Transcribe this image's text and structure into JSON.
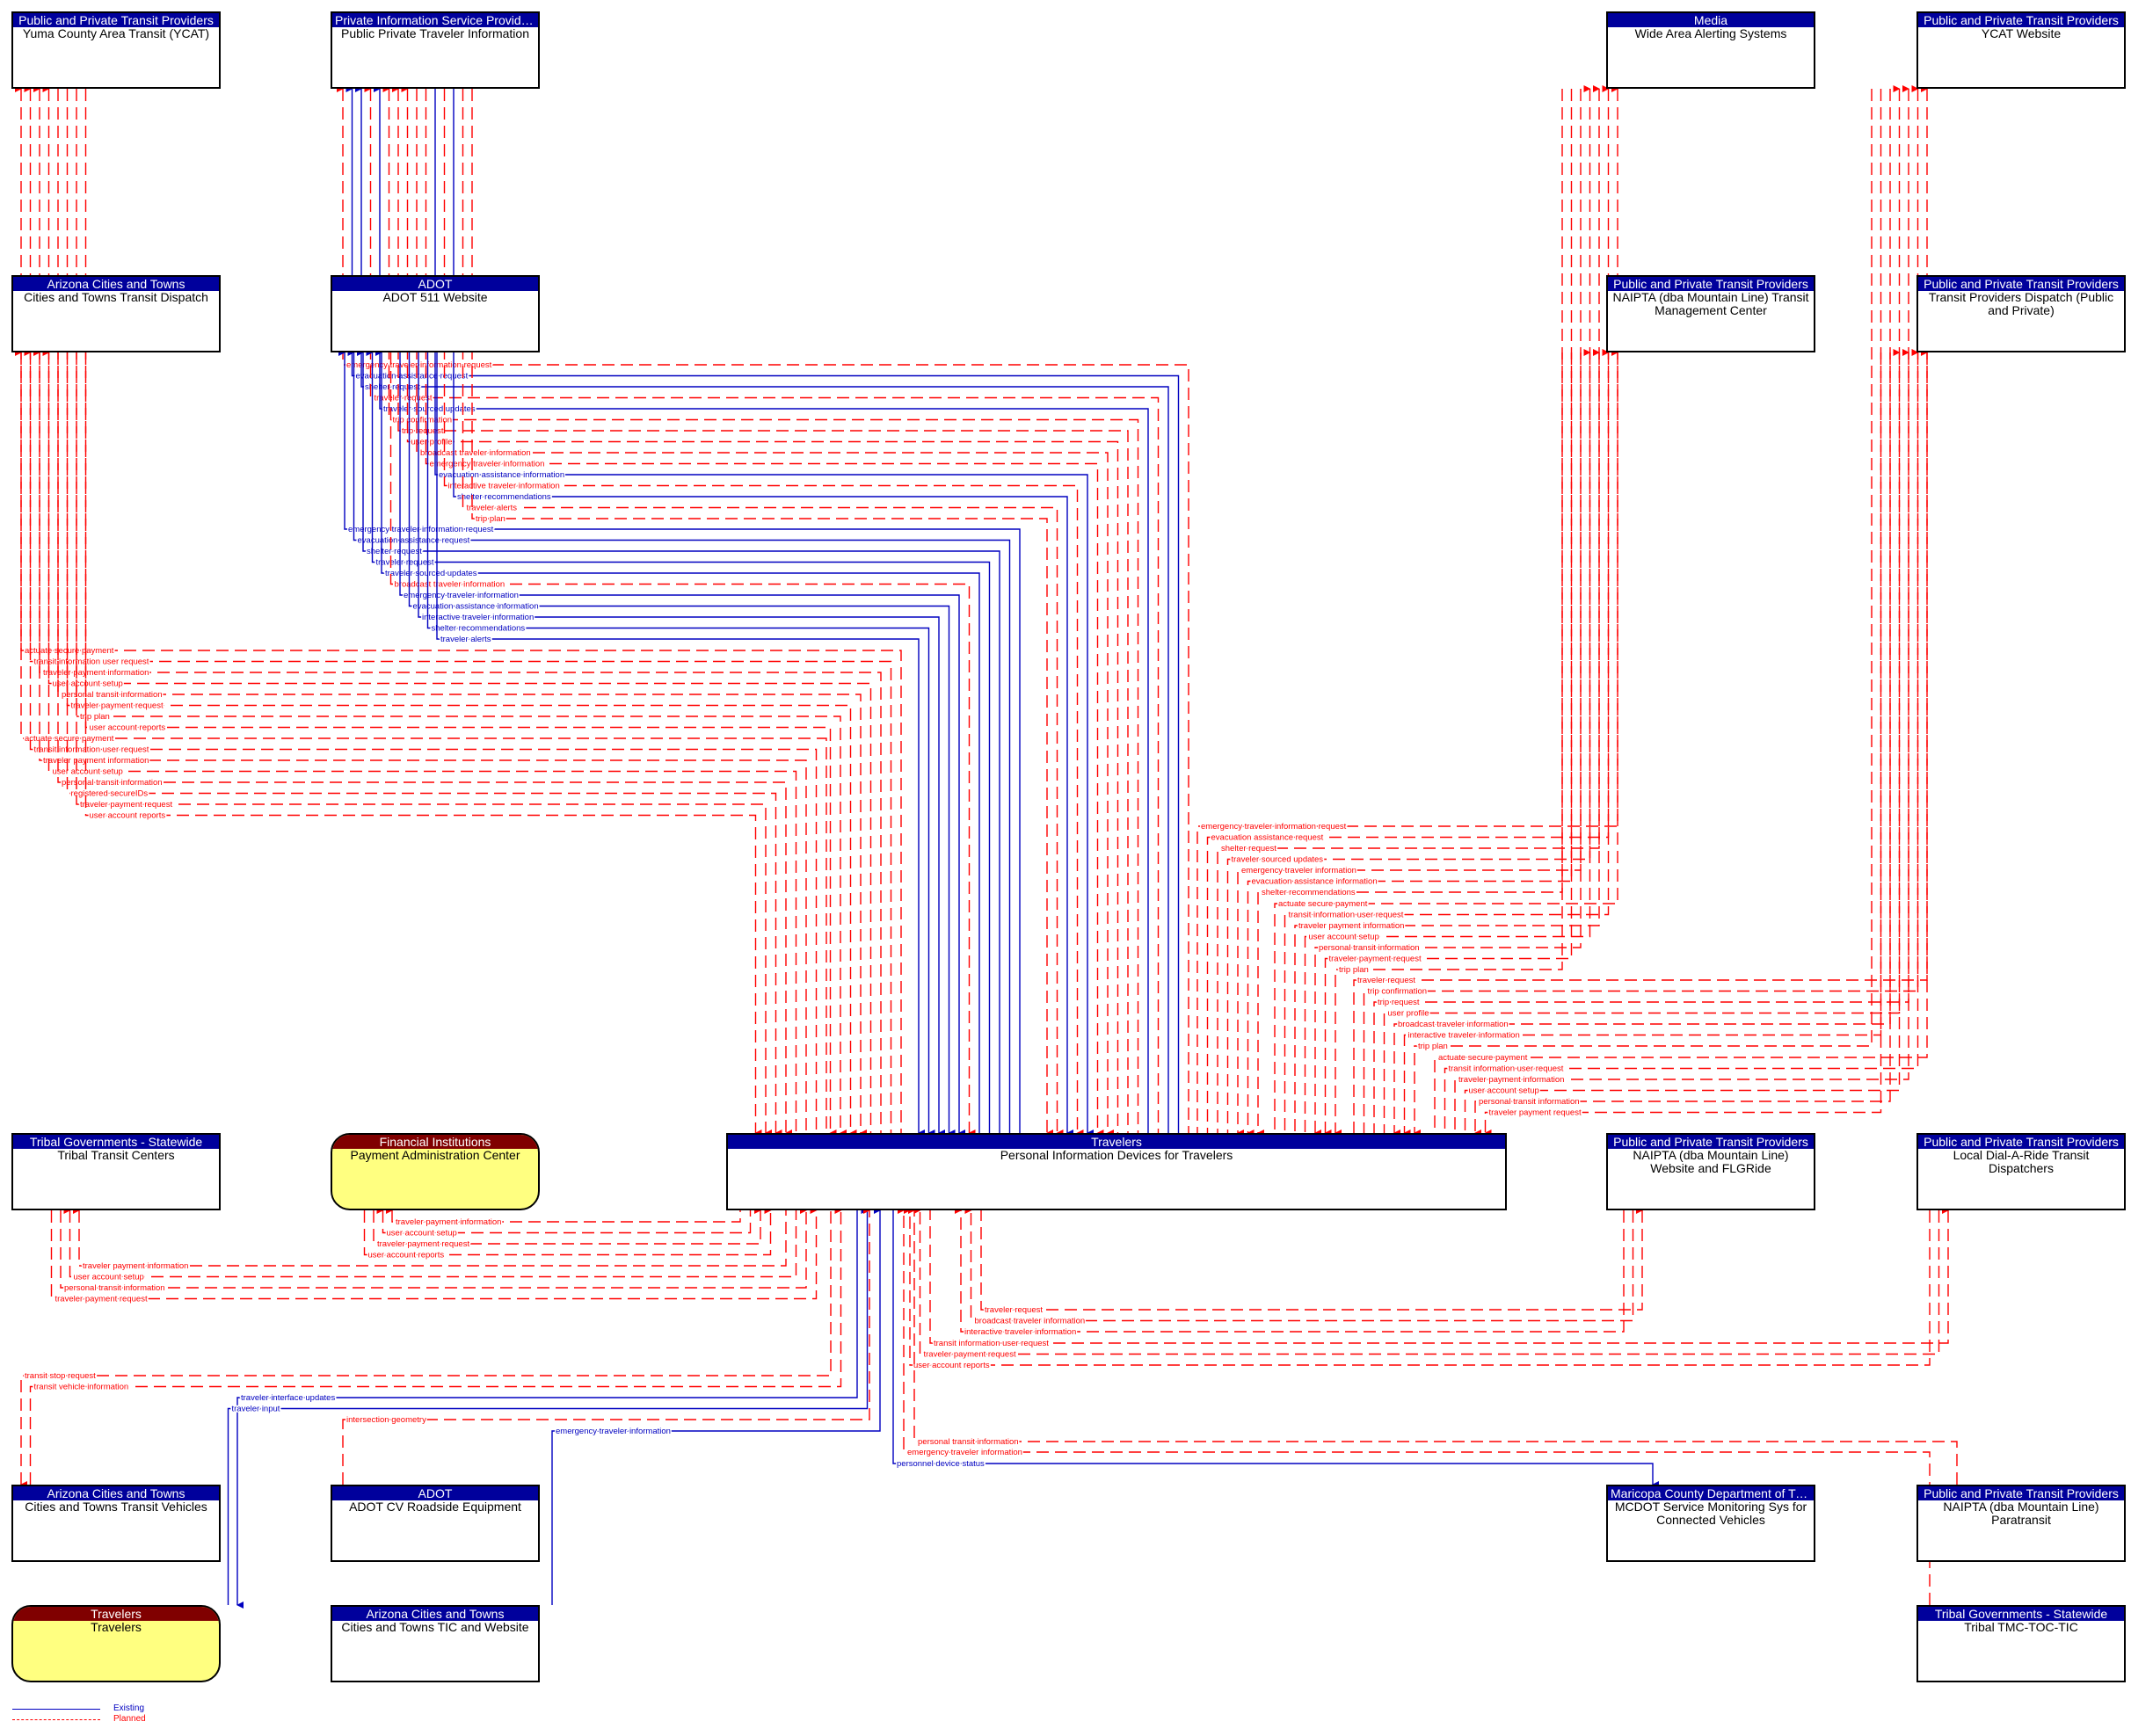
{
  "legend": {
    "existing_label": "Existing",
    "planned_label": "Planned",
    "existing_color": "#0000c0",
    "planned_color": "#ff0000"
  },
  "colors": {
    "element_header": "#00009c",
    "actor_header": "#800000",
    "actor_fill": "#ffff80"
  },
  "nodes": [
    {
      "id": "ycat",
      "category": "Public and Private Transit Providers",
      "name": "Yuma County Area Transit (YCAT)",
      "kind": "element"
    },
    {
      "id": "ppti",
      "category": "Private Information Service Providers",
      "name": "Public Private Traveler Information",
      "kind": "element"
    },
    {
      "id": "waas",
      "category": "Media",
      "name": "Wide Area Alerting Systems",
      "kind": "element"
    },
    {
      "id": "ycatweb",
      "category": "Public and Private Transit Providers",
      "name": "YCAT Website",
      "kind": "element"
    },
    {
      "id": "cttd",
      "category": "Arizona Cities and Towns",
      "name": "Cities and Towns Transit Dispatch",
      "kind": "element"
    },
    {
      "id": "adot511",
      "category": "ADOT",
      "name": "ADOT 511 Website",
      "kind": "element"
    },
    {
      "id": "naiptatmc",
      "category": "Public and Private Transit Providers",
      "name": "NAIPTA (dba Mountain Line) Transit Management Center",
      "kind": "element"
    },
    {
      "id": "tpd",
      "category": "Public and Private Transit Providers",
      "name": "Transit Providers Dispatch (Public and Private)",
      "kind": "element"
    },
    {
      "id": "ttc",
      "category": "Tribal Governments - Statewide",
      "name": "Tribal Transit Centers",
      "kind": "element"
    },
    {
      "id": "pac",
      "category": "Financial Institutions",
      "name": "Payment Administration Center",
      "kind": "actor"
    },
    {
      "id": "pid",
      "category": "Travelers",
      "name": "Personal Information Devices for Travelers",
      "kind": "element"
    },
    {
      "id": "naiptaweb",
      "category": "Public and Private Transit Providers",
      "name": "NAIPTA (dba Mountain Line) Website and FLGRide",
      "kind": "element"
    },
    {
      "id": "ldar",
      "category": "Public and Private Transit Providers",
      "name": "Local Dial-A-Ride Transit Dispatchers",
      "kind": "element"
    },
    {
      "id": "cttv",
      "category": "Arizona Cities and Towns",
      "name": "Cities and Towns Transit Vehicles",
      "kind": "element"
    },
    {
      "id": "adotcv",
      "category": "ADOT",
      "name": "ADOT CV Roadside Equipment",
      "kind": "element"
    },
    {
      "id": "mcdot",
      "category": "Maricopa County Department of Tran...",
      "name": "MCDOT Service Monitoring Sys for Connected Vehicles",
      "kind": "element"
    },
    {
      "id": "naiptapara",
      "category": "Public and Private Transit Providers",
      "name": "NAIPTA (dba Mountain Line) Paratransit",
      "kind": "element"
    },
    {
      "id": "travelers",
      "category": "Travelers",
      "name": "Travelers",
      "kind": "actor"
    },
    {
      "id": "cttic",
      "category": "Arizona Cities and Towns",
      "name": "Cities and Towns TIC and Website",
      "kind": "element"
    },
    {
      "id": "tribaltmc",
      "category": "Tribal Governments - Statewide",
      "name": "Tribal TMC-TOC-TIC",
      "kind": "element"
    }
  ],
  "flows": [
    {
      "group": "ppti",
      "label": "emergency traveler information request",
      "status": "planned",
      "to": "ppti"
    },
    {
      "group": "ppti",
      "label": "evacuation assistance request",
      "status": "existing",
      "to": "ppti"
    },
    {
      "group": "ppti",
      "label": "shelter request",
      "status": "existing",
      "to": "ppti"
    },
    {
      "group": "ppti",
      "label": "traveler request",
      "status": "planned",
      "to": "ppti"
    },
    {
      "group": "ppti",
      "label": "traveler sourced updates",
      "status": "existing",
      "to": "ppti"
    },
    {
      "group": "ppti",
      "label": "trip confirmation",
      "status": "planned",
      "to": "ppti"
    },
    {
      "group": "ppti",
      "label": "trip request",
      "status": "planned",
      "to": "ppti"
    },
    {
      "group": "ppti",
      "label": "user profile",
      "status": "planned",
      "to": "ppti"
    },
    {
      "group": "ppti",
      "label": "broadcast traveler information",
      "status": "planned",
      "to": "pid"
    },
    {
      "group": "ppti",
      "label": "emergency traveler information",
      "status": "planned",
      "to": "pid"
    },
    {
      "group": "ppti",
      "label": "evacuation assistance information",
      "status": "existing",
      "to": "pid"
    },
    {
      "group": "ppti",
      "label": "interactive traveler information",
      "status": "planned",
      "to": "pid"
    },
    {
      "group": "ppti",
      "label": "shelter recommendations",
      "status": "existing",
      "to": "pid"
    },
    {
      "group": "ppti",
      "label": "traveler alerts",
      "status": "planned",
      "to": "pid"
    },
    {
      "group": "ppti",
      "label": "trip plan",
      "status": "planned",
      "to": "pid"
    },
    {
      "group": "adot511",
      "label": "emergency traveler information request",
      "status": "existing",
      "to": "adot511"
    },
    {
      "group": "adot511",
      "label": "evacuation assistance request",
      "status": "existing",
      "to": "adot511"
    },
    {
      "group": "adot511",
      "label": "shelter request",
      "status": "existing",
      "to": "adot511"
    },
    {
      "group": "adot511",
      "label": "traveler request",
      "status": "existing",
      "to": "adot511"
    },
    {
      "group": "adot511",
      "label": "traveler sourced updates",
      "status": "existing",
      "to": "adot511"
    },
    {
      "group": "adot511",
      "label": "broadcast traveler information",
      "status": "planned",
      "to": "pid"
    },
    {
      "group": "adot511",
      "label": "emergency traveler information",
      "status": "existing",
      "to": "pid"
    },
    {
      "group": "adot511",
      "label": "evacuation assistance information",
      "status": "existing",
      "to": "pid"
    },
    {
      "group": "adot511",
      "label": "interactive traveler information",
      "status": "existing",
      "to": "pid"
    },
    {
      "group": "adot511",
      "label": "shelter recommendations",
      "status": "existing",
      "to": "pid"
    },
    {
      "group": "adot511",
      "label": "traveler alerts",
      "status": "existing",
      "to": "pid"
    },
    {
      "group": "ycat",
      "label": "actuate secure payment",
      "status": "planned",
      "to": "ycat"
    },
    {
      "group": "ycat",
      "label": "transit information user request",
      "status": "planned",
      "to": "ycat"
    },
    {
      "group": "ycat",
      "label": "traveler payment information",
      "status": "planned",
      "to": "ycat"
    },
    {
      "group": "ycat",
      "label": "user account setup",
      "status": "planned",
      "to": "ycat"
    },
    {
      "group": "ycat",
      "label": "personal transit information",
      "status": "planned",
      "to": "pid"
    },
    {
      "group": "ycat",
      "label": "traveler payment request",
      "status": "planned",
      "to": "pid"
    },
    {
      "group": "ycat",
      "label": "trip plan",
      "status": "planned",
      "to": "pid"
    },
    {
      "group": "ycat",
      "label": "user account reports",
      "status": "planned",
      "to": "pid"
    },
    {
      "group": "cttd",
      "label": "actuate secure payment",
      "status": "planned",
      "to": "cttd"
    },
    {
      "group": "cttd",
      "label": "transit information user request",
      "status": "planned",
      "to": "cttd"
    },
    {
      "group": "cttd",
      "label": "traveler payment information",
      "status": "planned",
      "to": "cttd"
    },
    {
      "group": "cttd",
      "label": "user account setup",
      "status": "planned",
      "to": "cttd"
    },
    {
      "group": "cttd",
      "label": "personal transit information",
      "status": "planned",
      "to": "pid"
    },
    {
      "group": "cttd",
      "label": "registered secureIDs",
      "status": "planned",
      "to": "pid"
    },
    {
      "group": "cttd",
      "label": "traveler payment request",
      "status": "planned",
      "to": "pid"
    },
    {
      "group": "cttd",
      "label": "user account reports",
      "status": "planned",
      "to": "pid"
    },
    {
      "group": "waas",
      "label": "emergency traveler information request",
      "status": "planned",
      "to": "waas"
    },
    {
      "group": "waas",
      "label": "evacuation assistance request",
      "status": "planned",
      "to": "waas"
    },
    {
      "group": "waas",
      "label": "shelter request",
      "status": "planned",
      "to": "waas"
    },
    {
      "group": "waas",
      "label": "traveler sourced updates",
      "status": "planned",
      "to": "waas"
    },
    {
      "group": "waas",
      "label": "emergency traveler information",
      "status": "planned",
      "to": "pid"
    },
    {
      "group": "waas",
      "label": "evacuation assistance information",
      "status": "planned",
      "to": "pid"
    },
    {
      "group": "waas",
      "label": "shelter recommendations",
      "status": "planned",
      "to": "pid"
    },
    {
      "group": "naiptatmc",
      "label": "actuate secure payment",
      "status": "planned",
      "to": "naiptatmc"
    },
    {
      "group": "naiptatmc",
      "label": "transit information user request",
      "status": "planned",
      "to": "naiptatmc"
    },
    {
      "group": "naiptatmc",
      "label": "traveler payment information",
      "status": "planned",
      "to": "naiptatmc"
    },
    {
      "group": "naiptatmc",
      "label": "user account setup",
      "status": "planned",
      "to": "naiptatmc"
    },
    {
      "group": "naiptatmc",
      "label": "personal transit information",
      "status": "planned",
      "to": "pid"
    },
    {
      "group": "naiptatmc",
      "label": "traveler payment request",
      "status": "planned",
      "to": "pid"
    },
    {
      "group": "naiptatmc",
      "label": "trip plan",
      "status": "planned",
      "to": "pid"
    },
    {
      "group": "ycatweb",
      "label": "traveler request",
      "status": "planned",
      "to": "ycatweb"
    },
    {
      "group": "ycatweb",
      "label": "trip confirmation",
      "status": "planned",
      "to": "ycatweb"
    },
    {
      "group": "ycatweb",
      "label": "trip request",
      "status": "planned",
      "to": "ycatweb"
    },
    {
      "group": "ycatweb",
      "label": "user profile",
      "status": "planned",
      "to": "ycatweb"
    },
    {
      "group": "ycatweb",
      "label": "broadcast traveler information",
      "status": "planned",
      "to": "pid"
    },
    {
      "group": "ycatweb",
      "label": "interactive traveler information",
      "status": "planned",
      "to": "pid"
    },
    {
      "group": "ycatweb",
      "label": "trip plan",
      "status": "planned",
      "to": "pid"
    },
    {
      "group": "tpd",
      "label": "actuate secure payment",
      "status": "planned",
      "to": "tpd"
    },
    {
      "group": "tpd",
      "label": "transit information user request",
      "status": "planned",
      "to": "tpd"
    },
    {
      "group": "tpd",
      "label": "traveler payment information",
      "status": "planned",
      "to": "tpd"
    },
    {
      "group": "tpd",
      "label": "user account setup",
      "status": "planned",
      "to": "tpd"
    },
    {
      "group": "tpd",
      "label": "personal transit information",
      "status": "planned",
      "to": "pid"
    },
    {
      "group": "tpd",
      "label": "traveler payment request",
      "status": "planned",
      "to": "pid"
    },
    {
      "group": "pac",
      "label": "traveler payment information",
      "status": "planned",
      "to": "pac"
    },
    {
      "group": "pac",
      "label": "user account setup",
      "status": "planned",
      "to": "pac"
    },
    {
      "group": "pac",
      "label": "traveler payment request",
      "status": "planned",
      "to": "pid"
    },
    {
      "group": "pac",
      "label": "user account reports",
      "status": "planned",
      "to": "pid"
    },
    {
      "group": "ttc",
      "label": "traveler payment information",
      "status": "planned",
      "to": "ttc"
    },
    {
      "group": "ttc",
      "label": "user account setup",
      "status": "planned",
      "to": "ttc"
    },
    {
      "group": "ttc",
      "label": "personal transit information",
      "status": "planned",
      "to": "pid"
    },
    {
      "group": "ttc",
      "label": "traveler payment request",
      "status": "planned",
      "to": "pid"
    },
    {
      "group": "cttv",
      "label": "transit stop request",
      "status": "planned",
      "to": "cttv"
    },
    {
      "group": "cttv",
      "label": "transit vehicle information",
      "status": "planned",
      "to": "pid"
    },
    {
      "group": "travelers",
      "label": "traveler interface updates",
      "status": "existing",
      "to": "travelers"
    },
    {
      "group": "travelers",
      "label": "traveler input",
      "status": "existing",
      "to": "pid"
    },
    {
      "group": "adotcv",
      "label": "intersection geometry",
      "status": "planned",
      "to": "pid"
    },
    {
      "group": "cttic",
      "label": "emergency traveler information",
      "status": "existing",
      "to": "pid"
    },
    {
      "group": "naiptaweb",
      "label": "traveler request",
      "status": "planned",
      "to": "naiptaweb"
    },
    {
      "group": "naiptaweb",
      "label": "broadcast traveler information",
      "status": "planned",
      "to": "pid"
    },
    {
      "group": "naiptaweb",
      "label": "interactive traveler information",
      "status": "planned",
      "to": "pid"
    },
    {
      "group": "ldar",
      "label": "transit information user request",
      "status": "planned",
      "to": "ldar"
    },
    {
      "group": "ldar",
      "label": "traveler payment request",
      "status": "planned",
      "to": "pid"
    },
    {
      "group": "ldar",
      "label": "user account reports",
      "status": "planned",
      "to": "pid"
    },
    {
      "group": "naiptapara",
      "label": "personal transit information",
      "status": "planned",
      "to": "pid"
    },
    {
      "group": "tribaltmc",
      "label": "emergency traveler information",
      "status": "planned",
      "to": "pid"
    },
    {
      "group": "mcdot",
      "label": "personnel device status",
      "status": "existing",
      "to": "mcdot"
    }
  ]
}
